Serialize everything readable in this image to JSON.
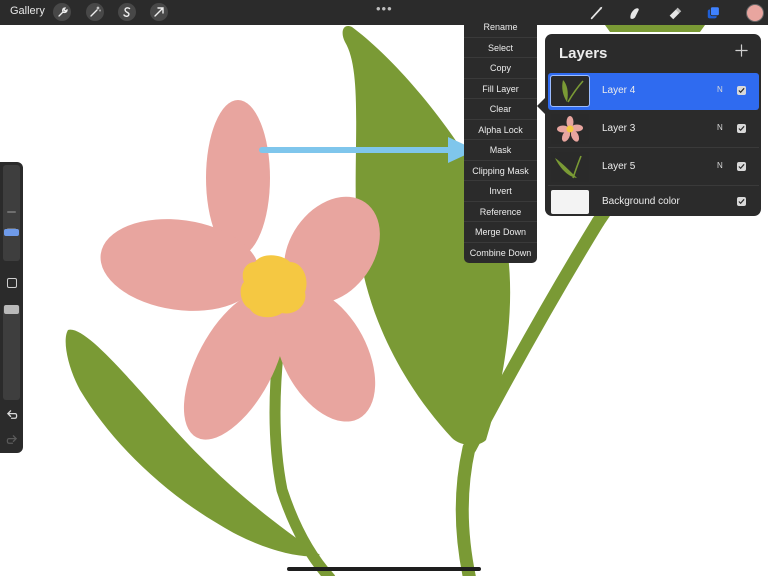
{
  "topbar": {
    "gallery_label": "Gallery",
    "left_tools": [
      "wrench-icon",
      "magic-wand-icon",
      "selection-s-icon",
      "transform-arrow-icon"
    ],
    "more_indicator": "•••",
    "right_tools": [
      "brush-icon",
      "smudge-icon",
      "eraser-icon",
      "layers-icon"
    ],
    "current_color": "#e8a59f"
  },
  "sidebar": {
    "size_slider_level": 0.2,
    "opacity_slider_level": 0.0,
    "modify_button": "modify-square-icon",
    "undo_icon": "undo-icon",
    "redo_icon": "redo-icon"
  },
  "context_menu": {
    "items": [
      "Rename",
      "Select",
      "Copy",
      "Fill Layer",
      "Clear",
      "Alpha Lock",
      "Mask",
      "Clipping Mask",
      "Invert",
      "Reference",
      "Merge Down",
      "Combine Down"
    ]
  },
  "layers_panel": {
    "title": "Layers",
    "add_icon": "plus-icon",
    "layers": [
      {
        "name": "Layer 4",
        "blend": "N",
        "visible": true,
        "active": true
      },
      {
        "name": "Layer 3",
        "blend": "N",
        "visible": true,
        "active": false
      },
      {
        "name": "Layer 5",
        "blend": "N",
        "visible": true,
        "active": false
      }
    ],
    "background": {
      "name": "Background color",
      "visible": true
    }
  },
  "colors": {
    "accent": "#2f6bf0",
    "panel": "#2b2b2b",
    "petal": "#e8a59f",
    "leaf": "#7a9a35",
    "flower_center": "#f5c842",
    "arrow": "#7fc6ec"
  }
}
